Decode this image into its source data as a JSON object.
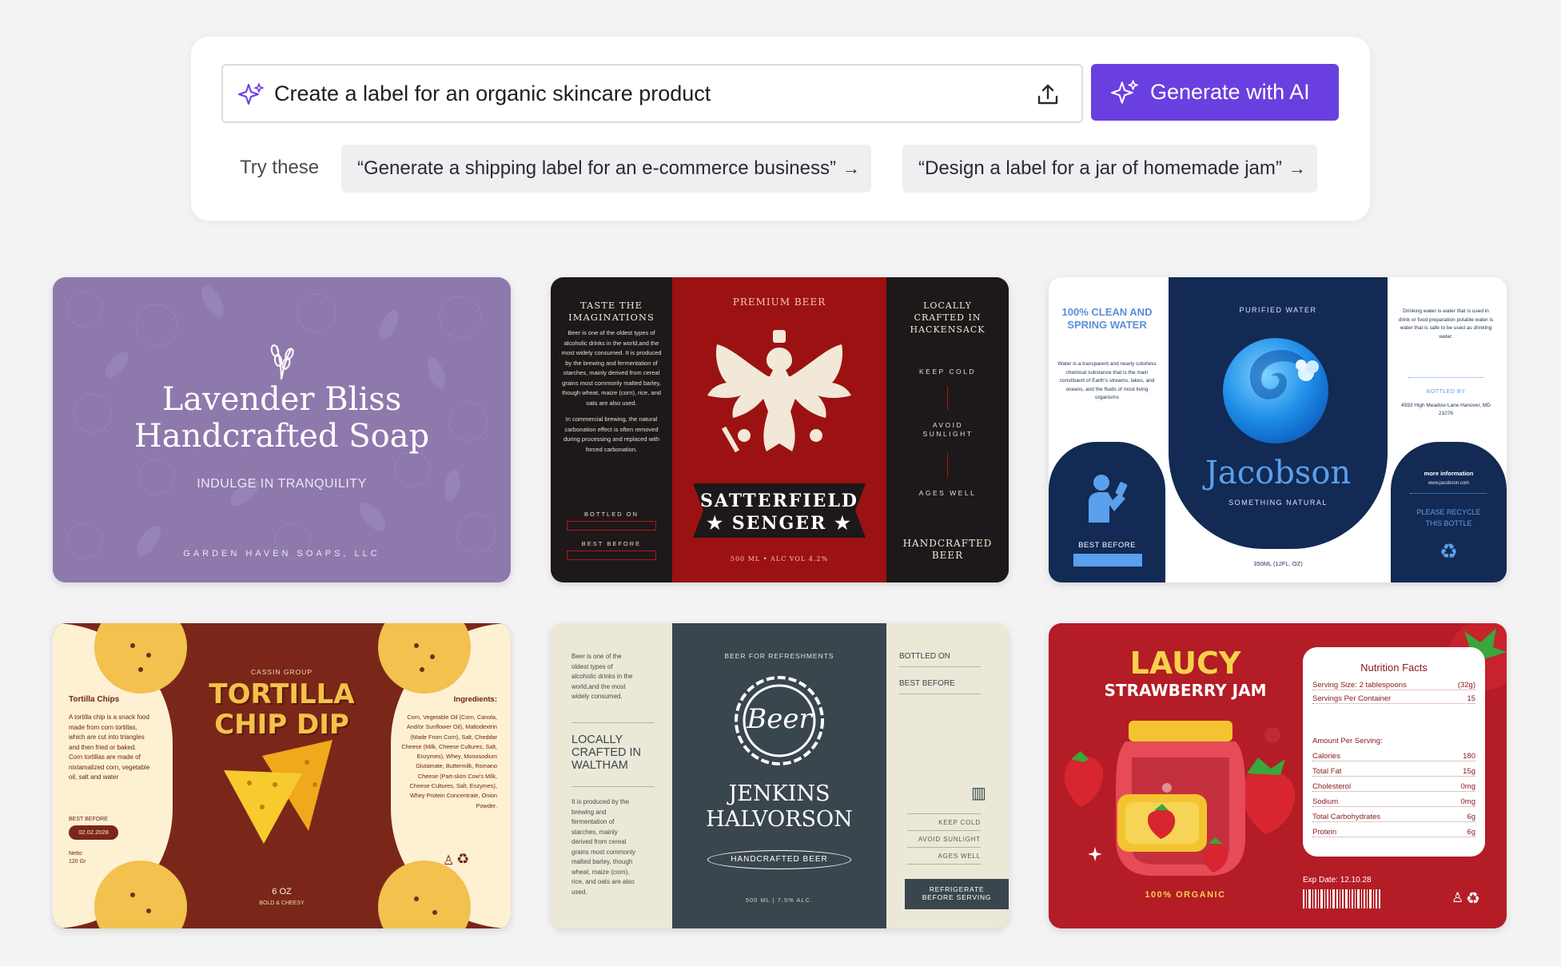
{
  "prompt": {
    "input_value": "Create a label for an organic skincare product",
    "generate_label": "Generate with AI",
    "try_label": "Try these",
    "suggestions": [
      "“Generate a shipping label for an e-commerce business”",
      "“Design a label for a jar of homemade jam”"
    ]
  },
  "cards": {
    "lavender": {
      "title_1": "Lavender Bliss",
      "title_2": "Handcrafted Soap",
      "tagline": "INDULGE IN TRANQUILITY",
      "brand": "GARDEN HAVEN SOAPS, LLC"
    },
    "beer": {
      "left_head_1": "TASTE THE",
      "left_head_2": "IMAGINATIONS",
      "left_body_1": "Beer is one of the oldest types of alcoholic drinks in the world,and the most widely consumed. It is produced by the brewing and fermentation of starches, mainly derived from cereal grains most commonly malted barley, though wheat, maize (corn), rice, and oats are also used.",
      "left_body_2": "In commercial brewing, the natural carbonation effect is often removed during processing and replaced with forced carbonation.",
      "bottled_on": "BOTTLED ON",
      "best_before": "BEST BEFORE",
      "premium": "PREMIUM BEER",
      "name_1": "SATTERFIELD",
      "name_2": "★ SENGER ★",
      "volume": "500 ML  •  ALC VOL 4.2%",
      "right_head": "LOCALLY CRAFTED IN HACKENSACK",
      "keep_cold": "KEEP COLD",
      "avoid_sunlight": "AVOID SUNLIGHT",
      "ages_well": "AGES WELL",
      "handcrafted": "HANDCRAFTED BEER"
    },
    "water": {
      "left_head": "100% CLEAN AND SPRING WATER",
      "left_body": "Water is a transparent and nearly colorless chemical substance that is the main constituent of Earth's streams, lakes, and oceans, and the fluids of most living organisms",
      "best_before": "BEST BEFORE",
      "purified": "PURIFIED WATER",
      "brand": "Jacobson",
      "sub": "SOMETHING NATURAL",
      "volume": "350ML (12FL. OZ)",
      "right_body": "Drinking water is water that is used in drink or food preparation potable water is water that is safe to be used as drinking water.",
      "bottled_by": "BOTTLED BY",
      "address": "4593 High Meadow Lane Hanover, MD 21076",
      "more_info": "more information",
      "website": "www.jacobson.com",
      "recycle": "PLEASE RECYCLE THIS BOTTLE"
    },
    "tortilla": {
      "left_head": "Tortilla Chips",
      "left_body": "A tortilla chip is a snack food made from corn tortillas, which are cut into triangles and then fried or baked. Corn tortillas are made of nixtamalized corn, vegetable oil, salt and water",
      "best_before": "BEST BEFORE",
      "date": "02.02.2028",
      "netto": "Netto",
      "weight": "120 Gr",
      "group": "CASSIN GROUP",
      "title_1": "TORTILLA",
      "title_2": "CHIP DIP",
      "oz": "6 OZ",
      "flavor": "BOLD & CHEESY",
      "ing_head": "Ingredients:",
      "ing_body": "Corn, Vegetable Oil (Corn, Canola, And/or Sunflower Oil), Maltodextrin (Made From Corn), Salt, Cheddar Cheese (Milk, Cheese Cultures, Salt, Enzymes), Whey, Monosodium Glutamate, Buttermilk, Romano Cheese (Part-skim Cow's Milk, Cheese Cultures, Salt, Enzymes), Whey Protein Concentrate, Onion Powder."
    },
    "jenkins": {
      "left_body_1": "Beer is one of the oldest types of alcoholic drinks in the world,and the most widely consumed.",
      "locally": "LOCALLY CRAFTED IN WALTHAM",
      "left_body_2": "It is produced by the brewing and fermentation of starches, mainly derived from cereal grains most commonly malted barley, though wheat, maize (corn), rice, and oats are also used.",
      "refresh": "BEER FOR REFRESHMENTS",
      "badge": "Beer",
      "name_1": "JENKINS",
      "name_2": "HALVORSON",
      "handcrafted": "HANDCRAFTED BEER",
      "volume": "500 ML  |  7.5% ALC.",
      "bottled_on": "BOTTLED ON",
      "best_before": "BEST BEFORE",
      "keep_cold": "KEEP COLD",
      "avoid_sunlight": "AVOID SUNLIGHT",
      "ages_well": "AGES WELL",
      "refrigerate": "REFRIGERATE BEFORE SERVING"
    },
    "jam": {
      "brand": "LAUCY",
      "product": "STRAWBERRY JAM",
      "organic": "100% ORGANIC",
      "nf_title": "Nutrition Facts",
      "serving_size": "Serving Size: 2 tablespoons",
      "serving_size_val": "(32g)",
      "servings": "Servings Per Container",
      "servings_val": "15",
      "amount": "Amount Per Serving:",
      "rows": [
        {
          "k": "Calories",
          "v": "180"
        },
        {
          "k": "Total Fat",
          "v": "15g"
        },
        {
          "k": "Cholesterol",
          "v": "0mg"
        },
        {
          "k": "Sodium",
          "v": "0mg"
        },
        {
          "k": "Total Carbohydrates",
          "v": "6g"
        },
        {
          "k": "Protein",
          "v": "6g"
        }
      ],
      "exp": "Exp Date: 12.10.28"
    }
  },
  "colors": {
    "accent": "#6a3fe0",
    "lavender": "#8e79ad",
    "beer_red": "#9c1212",
    "water_navy": "#122a54",
    "tortilla_brown": "#7a2719",
    "jenkins_slate": "#3a464d",
    "jam_red": "#b41c26"
  }
}
